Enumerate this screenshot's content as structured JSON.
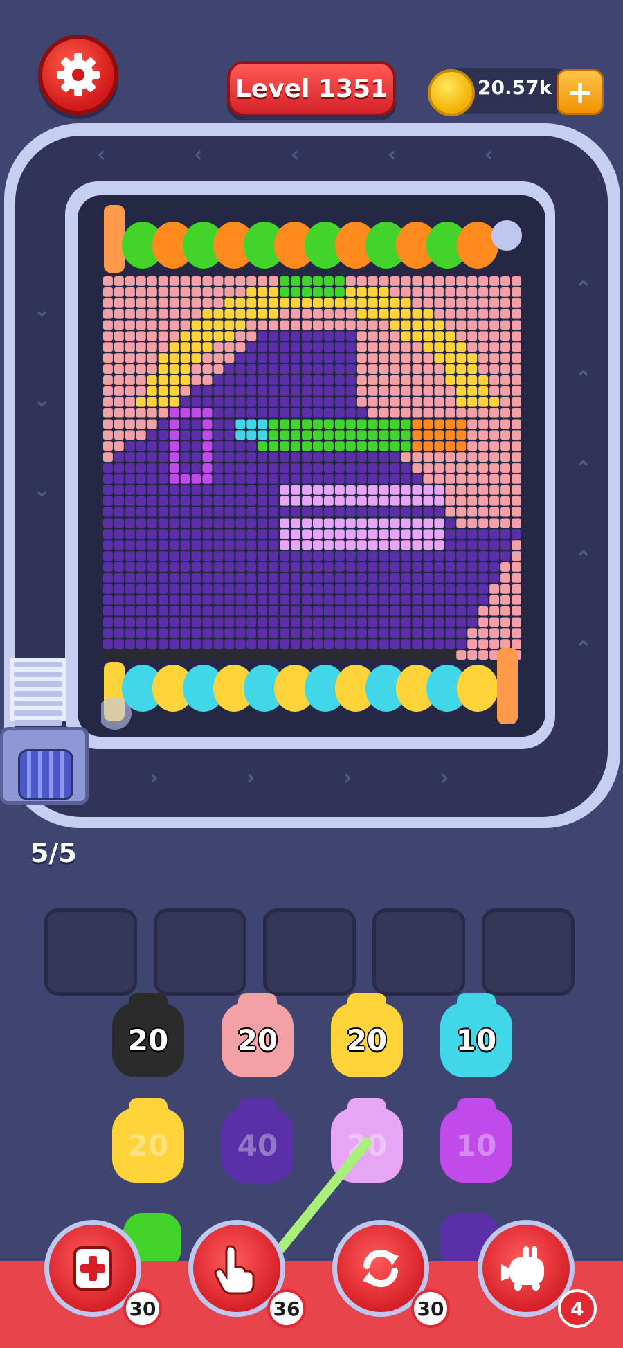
{
  "hud": {
    "level_label": "Level 1351",
    "coins": "20.57k",
    "coin_plus": "+"
  },
  "tray": {
    "counter": "5/5"
  },
  "pieces": [
    {
      "value": "20",
      "color": "#2b2b2b"
    },
    {
      "value": "20",
      "color": "#f4a0a7"
    },
    {
      "value": "20",
      "color": "#ffd43b"
    },
    {
      "value": "10",
      "color": "#40d8e8"
    },
    {
      "value": "20",
      "color": "#ffd43b"
    },
    {
      "value": "40",
      "color": "#5a2fa8"
    },
    {
      "value": "20",
      "color": "#e6a6f5"
    },
    {
      "value": "10",
      "color": "#c04bea"
    }
  ],
  "boosters": [
    {
      "name": "add-slot",
      "count": "30"
    },
    {
      "name": "pick",
      "count": "36"
    },
    {
      "name": "shuffle",
      "count": "30"
    },
    {
      "name": "train",
      "count": "4"
    }
  ],
  "colors": {
    "background": "#3f4470",
    "pink": "#f4a0a7",
    "purple": "#5a2fa8",
    "yellow": "#ffd43b",
    "green": "#43d42c",
    "orange": "#ff8a1e",
    "cyan": "#40d8e8",
    "violet": "#c04bea",
    "black": "#2b2b2b"
  }
}
